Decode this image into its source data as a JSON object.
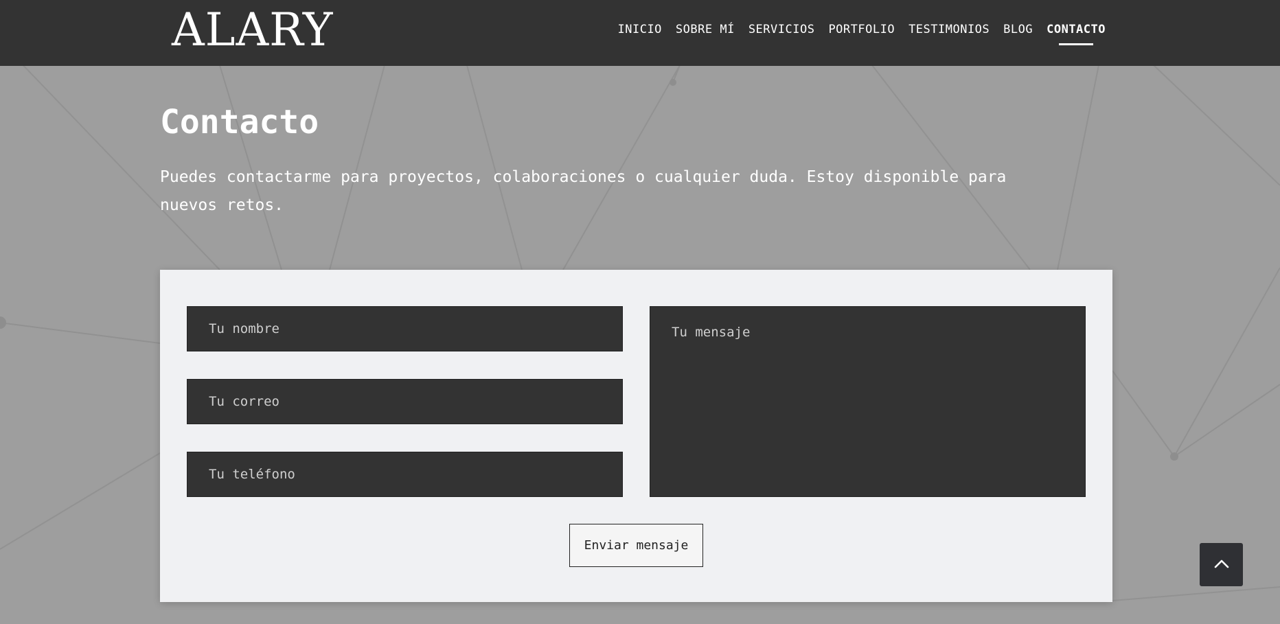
{
  "brand": {
    "logo_text": "ALARY"
  },
  "nav": {
    "items": [
      {
        "label": "INICIO"
      },
      {
        "label": "SOBRE MÍ"
      },
      {
        "label": "SERVICIOS"
      },
      {
        "label": "PORTFOLIO"
      },
      {
        "label": "TESTIMONIOS"
      },
      {
        "label": "BLOG"
      },
      {
        "label": "CONTACTO",
        "active": true
      }
    ]
  },
  "contact": {
    "title": "Contacto",
    "intro": "Puedes contactarme para proyectos, colaboraciones o cualquier duda. Estoy disponible para nuevos retos.",
    "form": {
      "name_placeholder": "Tu nombre",
      "email_placeholder": "Tu correo",
      "phone_placeholder": "Tu teléfono",
      "message_placeholder": "Tu mensaje",
      "submit_label": "Enviar mensaje"
    }
  },
  "back_to_top": {
    "icon": "chevron-up-icon"
  },
  "colors": {
    "header_bg": "#333333",
    "page_bg": "#9e9e9e",
    "card_bg": "#f0f1f3",
    "field_bg": "#333333",
    "text_light": "#ffffff"
  }
}
